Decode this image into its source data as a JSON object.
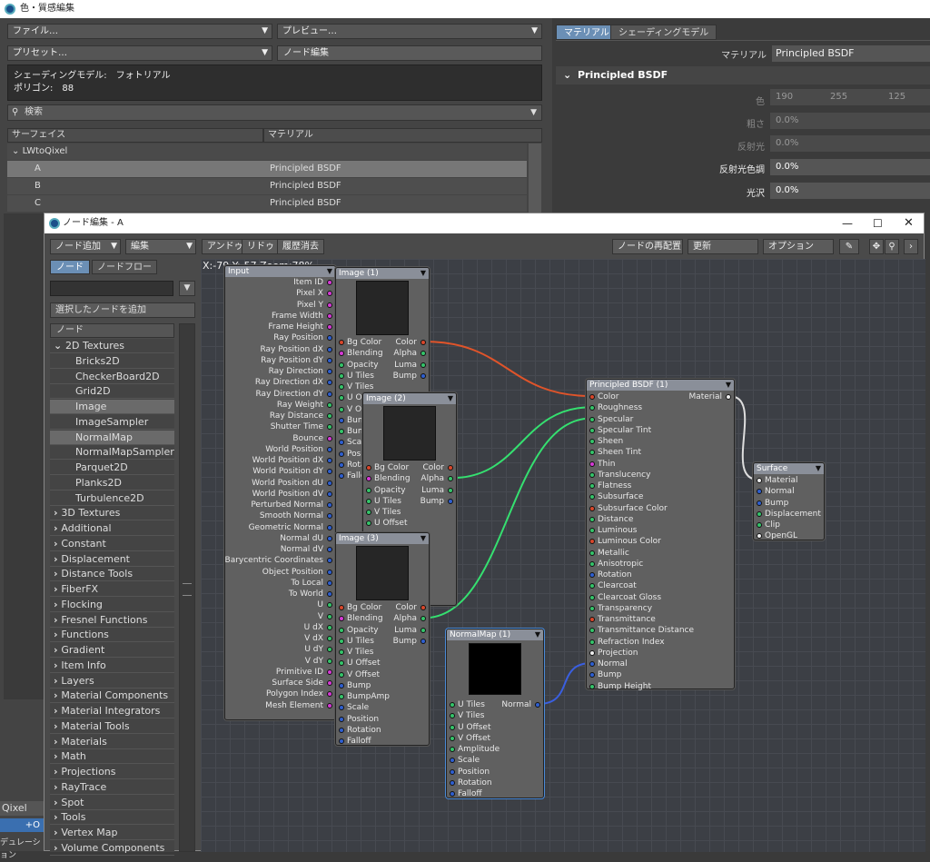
{
  "back_window": {
    "title": "色・質感編集",
    "file": "ファイル…",
    "preview": "プレビュー…",
    "preset": "プリセット…",
    "node_edit": "ノード編集",
    "shading_model_line": "シェーディングモデル:　フォトリアル",
    "polygon_line": "ポリゴン:　88",
    "search_placeholder": "検索",
    "col_surface": "サーフェイス",
    "col_material": "マテリアル",
    "group": "LWtoQixel",
    "rows": [
      {
        "name": "A",
        "material": "Principled BSDF"
      },
      {
        "name": "B",
        "material": "Principled BSDF"
      },
      {
        "name": "C",
        "material": "Principled BSDF"
      }
    ],
    "tab_material": "マテリアル",
    "tab_shading": "シェーディングモデル",
    "material_label": "マテリアル",
    "material_value": "Principled BSDF",
    "section_title": "Principled BSDF",
    "props": [
      {
        "label": "色",
        "value": "190",
        "v2": "255",
        "v3": "125"
      },
      {
        "label": "粗さ",
        "value": "0.0%"
      },
      {
        "label": "反射光",
        "value": "0.0%"
      },
      {
        "label": "反射光色調",
        "value": "0.0%"
      },
      {
        "label": "光沢",
        "value": "0.0%"
      }
    ],
    "left_bottom_1": "Qixel",
    "left_bottom_2": "+O",
    "left_bottom_3": "デュレーション"
  },
  "node_editor": {
    "title": "ノード編集 - A",
    "toolbar": {
      "add_node": "ノード追加",
      "edit": "編集",
      "undo": "アンドゥ",
      "redo": "リドゥ",
      "clear_history": "履歴消去",
      "rearrange": "ノードの再配置",
      "update": "更新",
      "options": "オプション"
    },
    "tabs": {
      "node": "ノード",
      "flow": "ノードフロー"
    },
    "add_selected": "選択したノードを追加",
    "list_header": "ノード",
    "status": "X:-79 Y:-57 Zoom:78%",
    "tree": [
      {
        "label": "2D Textures",
        "open": true
      },
      {
        "label": "Bricks2D",
        "child": true
      },
      {
        "label": "CheckerBoard2D",
        "child": true
      },
      {
        "label": "Grid2D",
        "child": true
      },
      {
        "label": "Image",
        "child": true,
        "sel": true
      },
      {
        "label": "ImageSampler",
        "child": true
      },
      {
        "label": "NormalMap",
        "child": true,
        "sel": true
      },
      {
        "label": "NormalMapSampler",
        "child": true
      },
      {
        "label": "Parquet2D",
        "child": true
      },
      {
        "label": "Planks2D",
        "child": true
      },
      {
        "label": "Turbulence2D",
        "child": true
      },
      {
        "label": "3D Textures"
      },
      {
        "label": "Additional"
      },
      {
        "label": "Constant"
      },
      {
        "label": "Displacement"
      },
      {
        "label": "Distance Tools"
      },
      {
        "label": "FiberFX"
      },
      {
        "label": "Flocking"
      },
      {
        "label": "Fresnel Functions"
      },
      {
        "label": "Functions"
      },
      {
        "label": "Gradient"
      },
      {
        "label": "Item Info"
      },
      {
        "label": "Layers"
      },
      {
        "label": "Material Components"
      },
      {
        "label": "Material Integrators"
      },
      {
        "label": "Material Tools"
      },
      {
        "label": "Materials"
      },
      {
        "label": "Math"
      },
      {
        "label": "Projections"
      },
      {
        "label": "RayTrace"
      },
      {
        "label": "Spot"
      },
      {
        "label": "Tools"
      },
      {
        "label": "Vertex Map"
      },
      {
        "label": "Volume Components"
      }
    ],
    "nodes": {
      "input": {
        "title": "Input",
        "outputs": [
          "Item ID",
          "Pixel X",
          "Pixel Y",
          "Frame Width",
          "Frame Height",
          "Ray Position",
          "Ray Position dX",
          "Ray Position dY",
          "Ray Direction",
          "Ray Direction dX",
          "Ray Direction dY",
          "Ray Weight",
          "Ray Distance",
          "Shutter Time",
          "Bounce",
          "World Position",
          "World Position dX",
          "World Position dY",
          "World Position dU",
          "World Position dV",
          "Perturbed Normal",
          "Smooth Normal",
          "Geometric Normal",
          "Normal dU",
          "Normal dV",
          "Barycentric Coordinates",
          "Object Position",
          "To Local",
          "To World",
          "U",
          "V",
          "U dX",
          "V dX",
          "U dY",
          "V dY",
          "Primitive ID",
          "Surface Side",
          "Polygon Index",
          "Mesh Element"
        ]
      },
      "image1": {
        "title": "Image (1)",
        "inputs": [
          "Bg Color",
          "Blending",
          "Opacity",
          "U Tiles",
          "V Tiles",
          "U Offset",
          "V Offset",
          "Bump",
          "BumpAmp",
          "Scale",
          "Position",
          "Rotation",
          "Falloff"
        ],
        "outputs": [
          "Color",
          "Alpha",
          "Luma",
          "Bump"
        ]
      },
      "image2": {
        "title": "Image (2)",
        "inputs": [
          "Bg Color",
          "Blending",
          "Opacity",
          "U Tiles",
          "V Tiles",
          "U Offset"
        ],
        "outputs": [
          "Color",
          "Alpha",
          "Luma",
          "Bump"
        ]
      },
      "image3": {
        "title": "Image (3)",
        "inputs": [
          "Bg Color",
          "Blending",
          "Opacity",
          "U Tiles",
          "V Tiles",
          "U Offset",
          "V Offset",
          "Bump",
          "BumpAmp",
          "Scale",
          "Position",
          "Rotation",
          "Falloff"
        ],
        "outputs": [
          "Color",
          "Alpha",
          "Luma",
          "Bump"
        ]
      },
      "normalmap": {
        "title": "NormalMap (1)",
        "inputs": [
          "U Tiles",
          "V Tiles",
          "U Offset",
          "V Offset",
          "Amplitude",
          "Scale",
          "Position",
          "Rotation",
          "Falloff"
        ],
        "outputs": [
          "Normal"
        ]
      },
      "bsdf": {
        "title": "Principled BSDF (1)",
        "inputs": [
          "Color",
          "Roughness",
          "Specular",
          "Specular Tint",
          "Sheen",
          "Sheen Tint",
          "Thin",
          "Translucency",
          "Flatness",
          "Subsurface",
          "Subsurface Color",
          "Distance",
          "Luminous",
          "Luminous Color",
          "Metallic",
          "Anisotropic",
          "Rotation",
          "Clearcoat",
          "Clearcoat Gloss",
          "Transparency",
          "Transmittance",
          "Transmittance Distance",
          "Refraction Index",
          "Projection",
          "Normal",
          "Bump",
          "Bump Height"
        ],
        "outputs": [
          "Material"
        ]
      },
      "surface": {
        "title": "Surface",
        "inputs": [
          "Material",
          "Normal",
          "Bump",
          "Displacement",
          "Clip",
          "OpenGL"
        ]
      }
    }
  },
  "colors": {
    "color_port": "#d9472b",
    "scalar_port": "#35c46a",
    "vector_port": "#2f5fd0",
    "int_port": "#d63ad6",
    "wire_color": "#e0542a",
    "wire_alpha": "#35e070",
    "wire_normal": "#3a5fe0",
    "wire_material": "#dddddd"
  }
}
